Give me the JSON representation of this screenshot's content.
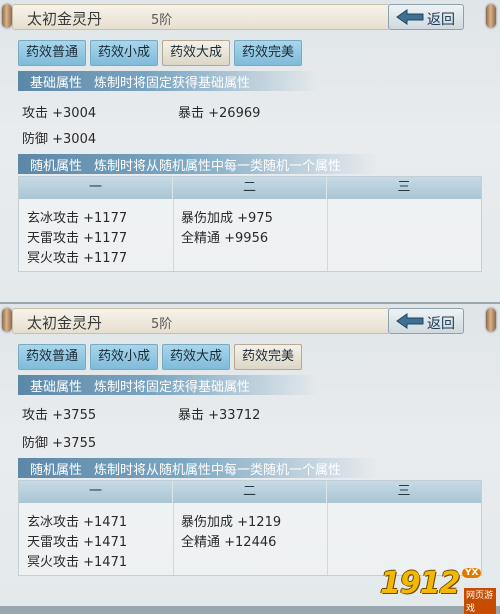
{
  "panels": [
    {
      "title": "太初金灵丹",
      "tier": "5阶",
      "back_label": "返回",
      "tabs": [
        "药效普通",
        "药效小成",
        "药效大成",
        "药效完美"
      ],
      "active_tab": 2,
      "base": {
        "tag": "基础属性",
        "desc": "炼制时将固定获得基础属性",
        "attack": "攻击 +3004",
        "crit": "暴击 +26969",
        "defense": "防御 +3004"
      },
      "random": {
        "tag": "随机属性",
        "desc": "炼制时将从随机属性中每一类随机一个属性",
        "columns": [
          "一",
          "二",
          "三"
        ],
        "col1": [
          "玄冰攻击 +1177",
          "天雷攻击 +1177",
          "冥火攻击 +1177"
        ],
        "col2": [
          "暴伤加成 +975",
          "全精通 +9956"
        ]
      }
    },
    {
      "title": "太初金灵丹",
      "tier": "5阶",
      "back_label": "返回",
      "tabs": [
        "药效普通",
        "药效小成",
        "药效大成",
        "药效完美"
      ],
      "active_tab": 3,
      "base": {
        "tag": "基础属性",
        "desc": "炼制时将固定获得基础属性",
        "attack": "攻击 +3755",
        "crit": "暴击 +33712",
        "defense": "防御 +3755"
      },
      "random": {
        "tag": "随机属性",
        "desc": "炼制时将从随机属性中每一类随机一个属性",
        "columns": [
          "一",
          "二",
          "三"
        ],
        "col1": [
          "玄冰攻击 +1471",
          "天雷攻击 +1471",
          "冥火攻击 +1471"
        ],
        "col2": [
          "暴伤加成 +1219",
          "全精通 +12446"
        ]
      }
    }
  ],
  "watermark": {
    "digits": "1912",
    "badge": "YX",
    "sub": "网页游戏"
  },
  "colors": {
    "tab_blue": "#8cc6e2",
    "tab_active": "#ece7dc",
    "section_header": "#6a94b2",
    "watermark_gold": "#f5b800"
  }
}
